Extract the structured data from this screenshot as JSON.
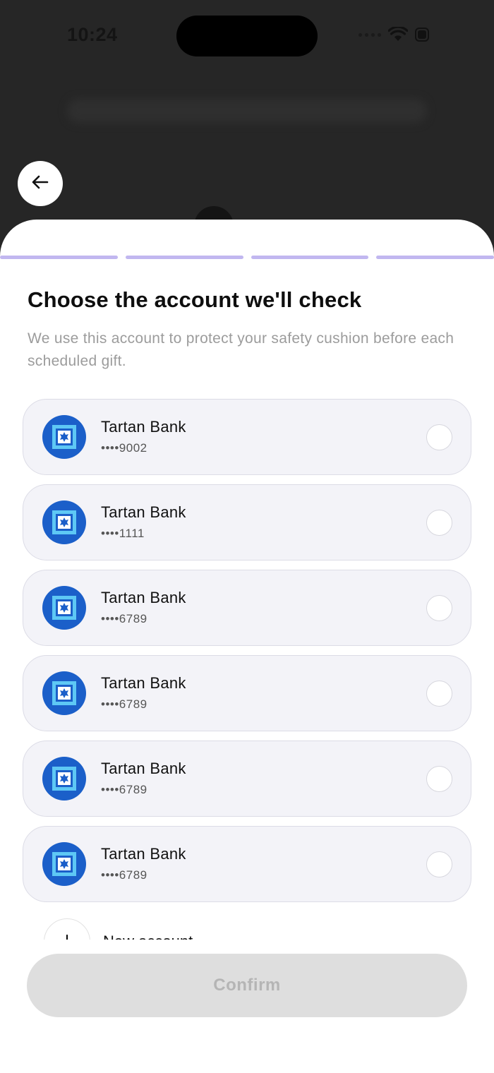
{
  "status_bar": {
    "time": "10:24"
  },
  "icons": {
    "back": "arrow-left-icon",
    "wifi": "wifi-icon",
    "battery": "battery-icon",
    "bank_logo": "tartan-bank-logo-icon",
    "add": "plus-icon"
  },
  "progress": {
    "steps_total": 4,
    "steps_completed": 4,
    "color": "#c1b7f0"
  },
  "sheet": {
    "title": "Choose the account we'll check",
    "subtitle": "We use this account to protect your safety cushion before each scheduled gift."
  },
  "accounts": [
    {
      "bank": "Tartan Bank",
      "number": "••••9002",
      "selected": false
    },
    {
      "bank": "Tartan Bank",
      "number": "••••1111",
      "selected": false
    },
    {
      "bank": "Tartan Bank",
      "number": "••••6789",
      "selected": false
    },
    {
      "bank": "Tartan Bank",
      "number": "••••6789",
      "selected": false
    },
    {
      "bank": "Tartan Bank",
      "number": "••••6789",
      "selected": false
    },
    {
      "bank": "Tartan Bank",
      "number": "••••6789",
      "selected": false
    }
  ],
  "new_account": {
    "label": "New account"
  },
  "confirm": {
    "label": "Confirm",
    "enabled": false
  },
  "colors": {
    "bank_logo_bg": "#1b5fc9",
    "accent_progress": "#c1b7f0",
    "confirm_disabled_bg": "#dedede"
  }
}
